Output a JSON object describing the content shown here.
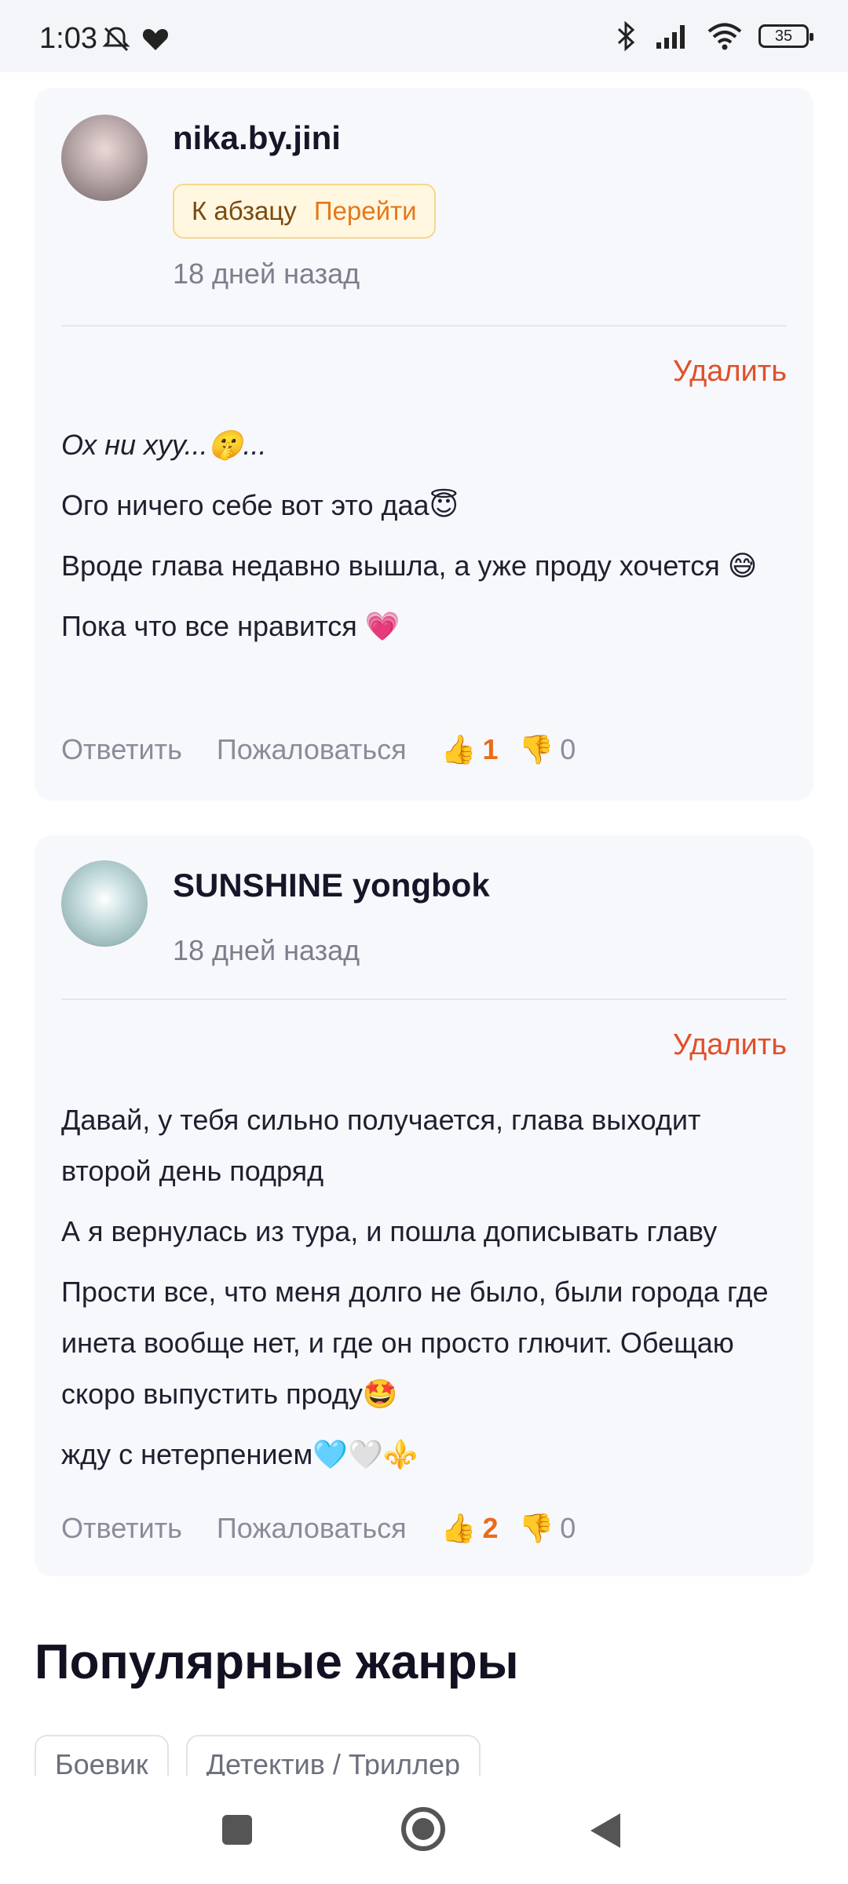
{
  "status_bar": {
    "time": "1:03",
    "icons": [
      "bell-off-icon",
      "heart-icon",
      "bluetooth-icon",
      "signal-icon",
      "wifi-icon"
    ],
    "battery": "35"
  },
  "comments": [
    {
      "username": "nika.by.jini",
      "chip": {
        "label": "К абзацу",
        "action": "Перейти"
      },
      "time": "18 дней назад",
      "delete_label": "Удалить",
      "lines": [
        {
          "text": "Ох ни хуу...🤫...",
          "italic": true
        },
        {
          "text": "Ого ничего себе вот это даа😇",
          "italic": false
        },
        {
          "text": "Вроде глава недавно вышла, а уже проду хочется 😅",
          "italic": false
        },
        {
          "text": "Пока что все нравится 💗",
          "italic": false
        }
      ],
      "reply_label": "Ответить",
      "report_label": "Пожаловаться",
      "likes": "1",
      "dislikes": "0"
    },
    {
      "username": "SUNSHINE yongbok",
      "time": "18 дней назад",
      "delete_label": "Удалить",
      "lines": [
        {
          "text": "Давай, у тебя сильно получается, глава выходит второй день подряд",
          "italic": false
        },
        {
          "text": "А я вернулась из тура, и пошла дописывать главу",
          "italic": false
        },
        {
          "text": "Прости все, что меня долго не было, были города где инета вообще нет, и где он просто глючит. Обещаю скоро выпустить проду🤩",
          "italic": false
        },
        {
          "text": "жду с нетерпением🩵🤍⚜️",
          "italic": false
        }
      ],
      "reply_label": "Ответить",
      "report_label": "Пожаловаться",
      "likes": "2",
      "dislikes": "0"
    }
  ],
  "genres_section": {
    "title": "Популярные жанры",
    "genres": [
      "Боевик",
      "Детектив / Триллер"
    ]
  },
  "colors": {
    "accent": "#e6771a",
    "delete": "#e0502a",
    "card_bg": "#f7f8fc"
  }
}
